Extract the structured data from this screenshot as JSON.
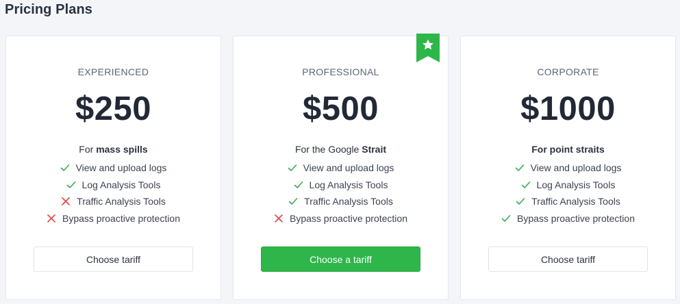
{
  "page": {
    "title": "Pricing Plans"
  },
  "colors": {
    "accent": "#2eb64a",
    "check": "#3aa956",
    "cross": "#e0474c",
    "ribbon": "#2eb64a"
  },
  "icons": {
    "included": "check-icon",
    "excluded": "cross-icon",
    "featured": "star-ribbon-icon"
  },
  "plans": [
    {
      "tier": "EXPERIENCED",
      "price": "$250",
      "desc_prefix": "For ",
      "desc_bold": "mass spills",
      "features": [
        {
          "label": "View and upload logs",
          "included": true
        },
        {
          "label": "Log Analysis Tools",
          "included": true
        },
        {
          "label": "Traffic Analysis Tools",
          "included": false
        },
        {
          "label": "Bypass proactive protection",
          "included": false
        }
      ],
      "button_label": "Choose tariff",
      "featured": false
    },
    {
      "tier": "PROFESSIONAL",
      "price": "$500",
      "desc_prefix": "For the Google ",
      "desc_bold": "Strait",
      "features": [
        {
          "label": "View and upload logs",
          "included": true
        },
        {
          "label": "Log Analysis Tools",
          "included": true
        },
        {
          "label": "Traffic Analysis Tools",
          "included": true
        },
        {
          "label": "Bypass proactive protection",
          "included": false
        }
      ],
      "button_label": "Choose a tariff",
      "featured": true
    },
    {
      "tier": "CORPORATE",
      "price": "$1000",
      "desc_prefix": "",
      "desc_bold": "For point straits",
      "features": [
        {
          "label": "View and upload logs",
          "included": true
        },
        {
          "label": "Log Analysis Tools",
          "included": true
        },
        {
          "label": "Traffic Analysis Tools",
          "included": true
        },
        {
          "label": "Bypass proactive protection",
          "included": true
        }
      ],
      "button_label": "Choose tariff",
      "featured": false
    }
  ]
}
